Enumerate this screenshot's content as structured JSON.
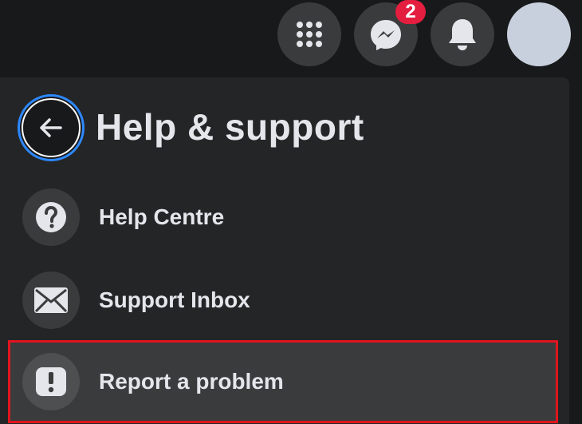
{
  "topbar": {
    "menu_icon": "grid-menu-icon",
    "messenger_icon": "messenger-icon",
    "messenger_badge": "2",
    "notifications_icon": "bell-icon",
    "avatar_label": "avatar"
  },
  "panel": {
    "title": "Help & support",
    "back_icon": "arrow-left-icon",
    "items": [
      {
        "label": "Help Centre",
        "icon": "question-icon"
      },
      {
        "label": "Support Inbox",
        "icon": "envelope-icon"
      },
      {
        "label": "Report a problem",
        "icon": "exclamation-icon"
      }
    ]
  },
  "colors": {
    "page_bg": "#18191a",
    "panel_bg": "#242526",
    "button_bg": "#3a3b3c",
    "text": "#e4e6eb",
    "badge": "#e41e3f",
    "focus_ring": "#2d88ff",
    "highlight_border": "#e0151f"
  }
}
